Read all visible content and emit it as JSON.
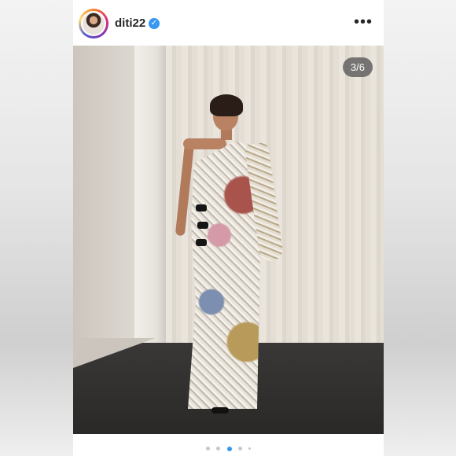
{
  "post": {
    "username": "diti22",
    "verified_icon": "verified-badge-icon",
    "more_icon": "more-options-icon",
    "more_label": "•••",
    "carousel_counter": "3/6",
    "carousel_current": 3,
    "carousel_total": 6
  },
  "colors": {
    "accent": "#3897f0",
    "text": "#262626"
  }
}
